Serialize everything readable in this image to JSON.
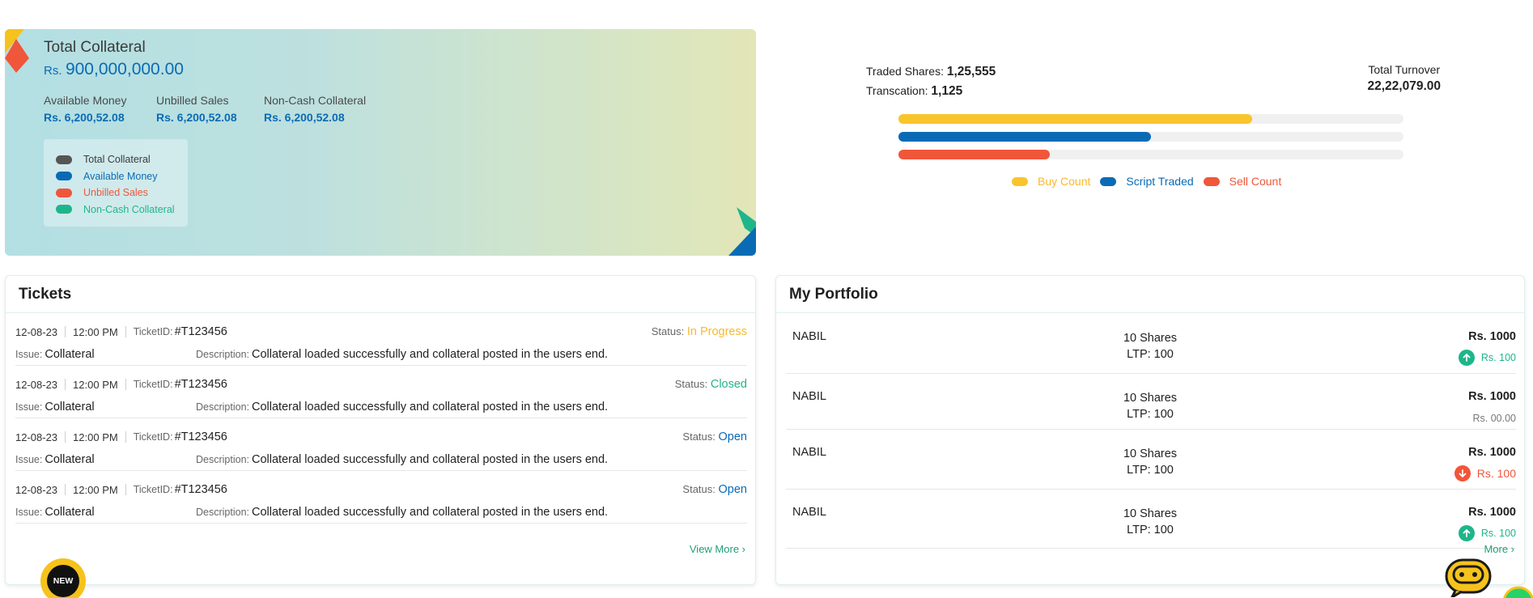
{
  "collateral": {
    "title": "Total Collateral",
    "currency": "Rs.",
    "amount": "900,000,000.00",
    "stats": [
      {
        "label": "Available Money",
        "value": "Rs. 6,200,52.08"
      },
      {
        "label": "Unbilled Sales",
        "value": "Rs. 6,200,52.08"
      },
      {
        "label": "Non-Cash Collateral",
        "value": "Rs. 6,200,52.08"
      }
    ],
    "legend": [
      {
        "label": "Total Collateral",
        "color": "#555555"
      },
      {
        "label": "Available Money",
        "color": "#0a6bb5"
      },
      {
        "label": "Unbilled Sales",
        "color": "#f0563a"
      },
      {
        "label": "Non-Cash Collateral",
        "color": "#1fb58a"
      }
    ]
  },
  "trading": {
    "traded_shares_label": "Traded Shares:",
    "traded_shares_value": "1,25,555",
    "transaction_label": "Transcation:",
    "transaction_value": "1,125",
    "turnover_label": "Total Turnover",
    "turnover_value": "22,22,079.00",
    "bars": [
      {
        "name": "Buy Count",
        "fraction": 0.7,
        "color": "#f9c52c"
      },
      {
        "name": "Script Traded",
        "fraction": 0.5,
        "color": "#0a6bb5"
      },
      {
        "name": "Sell Count",
        "fraction": 0.3,
        "color": "#f0563a"
      }
    ]
  },
  "tickets": {
    "title": "Tickets",
    "ticket_id_label": "TicketID:",
    "status_label": "Status:",
    "issue_label": "Issue:",
    "description_label": "Description:",
    "view_more": "View More ›",
    "rows": [
      {
        "date": "12-08-23",
        "time": "12:00 PM",
        "id": "#T123456",
        "status": "In Progress",
        "status_color": "#f9b92c",
        "issue": "Collateral",
        "description": "Collateral loaded successfully and collateral posted in the users end."
      },
      {
        "date": "12-08-23",
        "time": "12:00 PM",
        "id": "#T123456",
        "status": "Closed",
        "status_color": "#1fb58a",
        "issue": "Collateral",
        "description": "Collateral loaded successfully and collateral posted in the users end."
      },
      {
        "date": "12-08-23",
        "time": "12:00 PM",
        "id": "#T123456",
        "status": "Open",
        "status_color": "#0a6bb5",
        "issue": "Collateral",
        "description": "Collateral loaded successfully and collateral posted in the users end."
      },
      {
        "date": "12-08-23",
        "time": "12:00 PM",
        "id": "#T123456",
        "status": "Open",
        "status_color": "#0a6bb5",
        "issue": "Collateral",
        "description": "Collateral loaded successfully and collateral posted in the users end."
      }
    ]
  },
  "portfolio": {
    "title": "My Portfolio",
    "view_more": "More ›",
    "rows": [
      {
        "name": "NABIL",
        "shares": "10 Shares",
        "ltp": "LTP: 100",
        "price": "Rs. 1000",
        "change": "Rs. 100",
        "direction": "up"
      },
      {
        "name": "NABIL",
        "shares": "10 Shares",
        "ltp": "LTP: 100",
        "price": "Rs. 1000",
        "change": "Rs. 00.00",
        "direction": "none"
      },
      {
        "name": "NABIL",
        "shares": "10 Shares",
        "ltp": "LTP: 100",
        "price": "Rs. 1000",
        "change": "Rs. 100",
        "direction": "down"
      },
      {
        "name": "NABIL",
        "shares": "10 Shares",
        "ltp": "LTP: 100",
        "price": "Rs. 1000",
        "change": "Rs. 100",
        "direction": "up"
      }
    ]
  },
  "widgets": {
    "new_badge": "NEW"
  }
}
